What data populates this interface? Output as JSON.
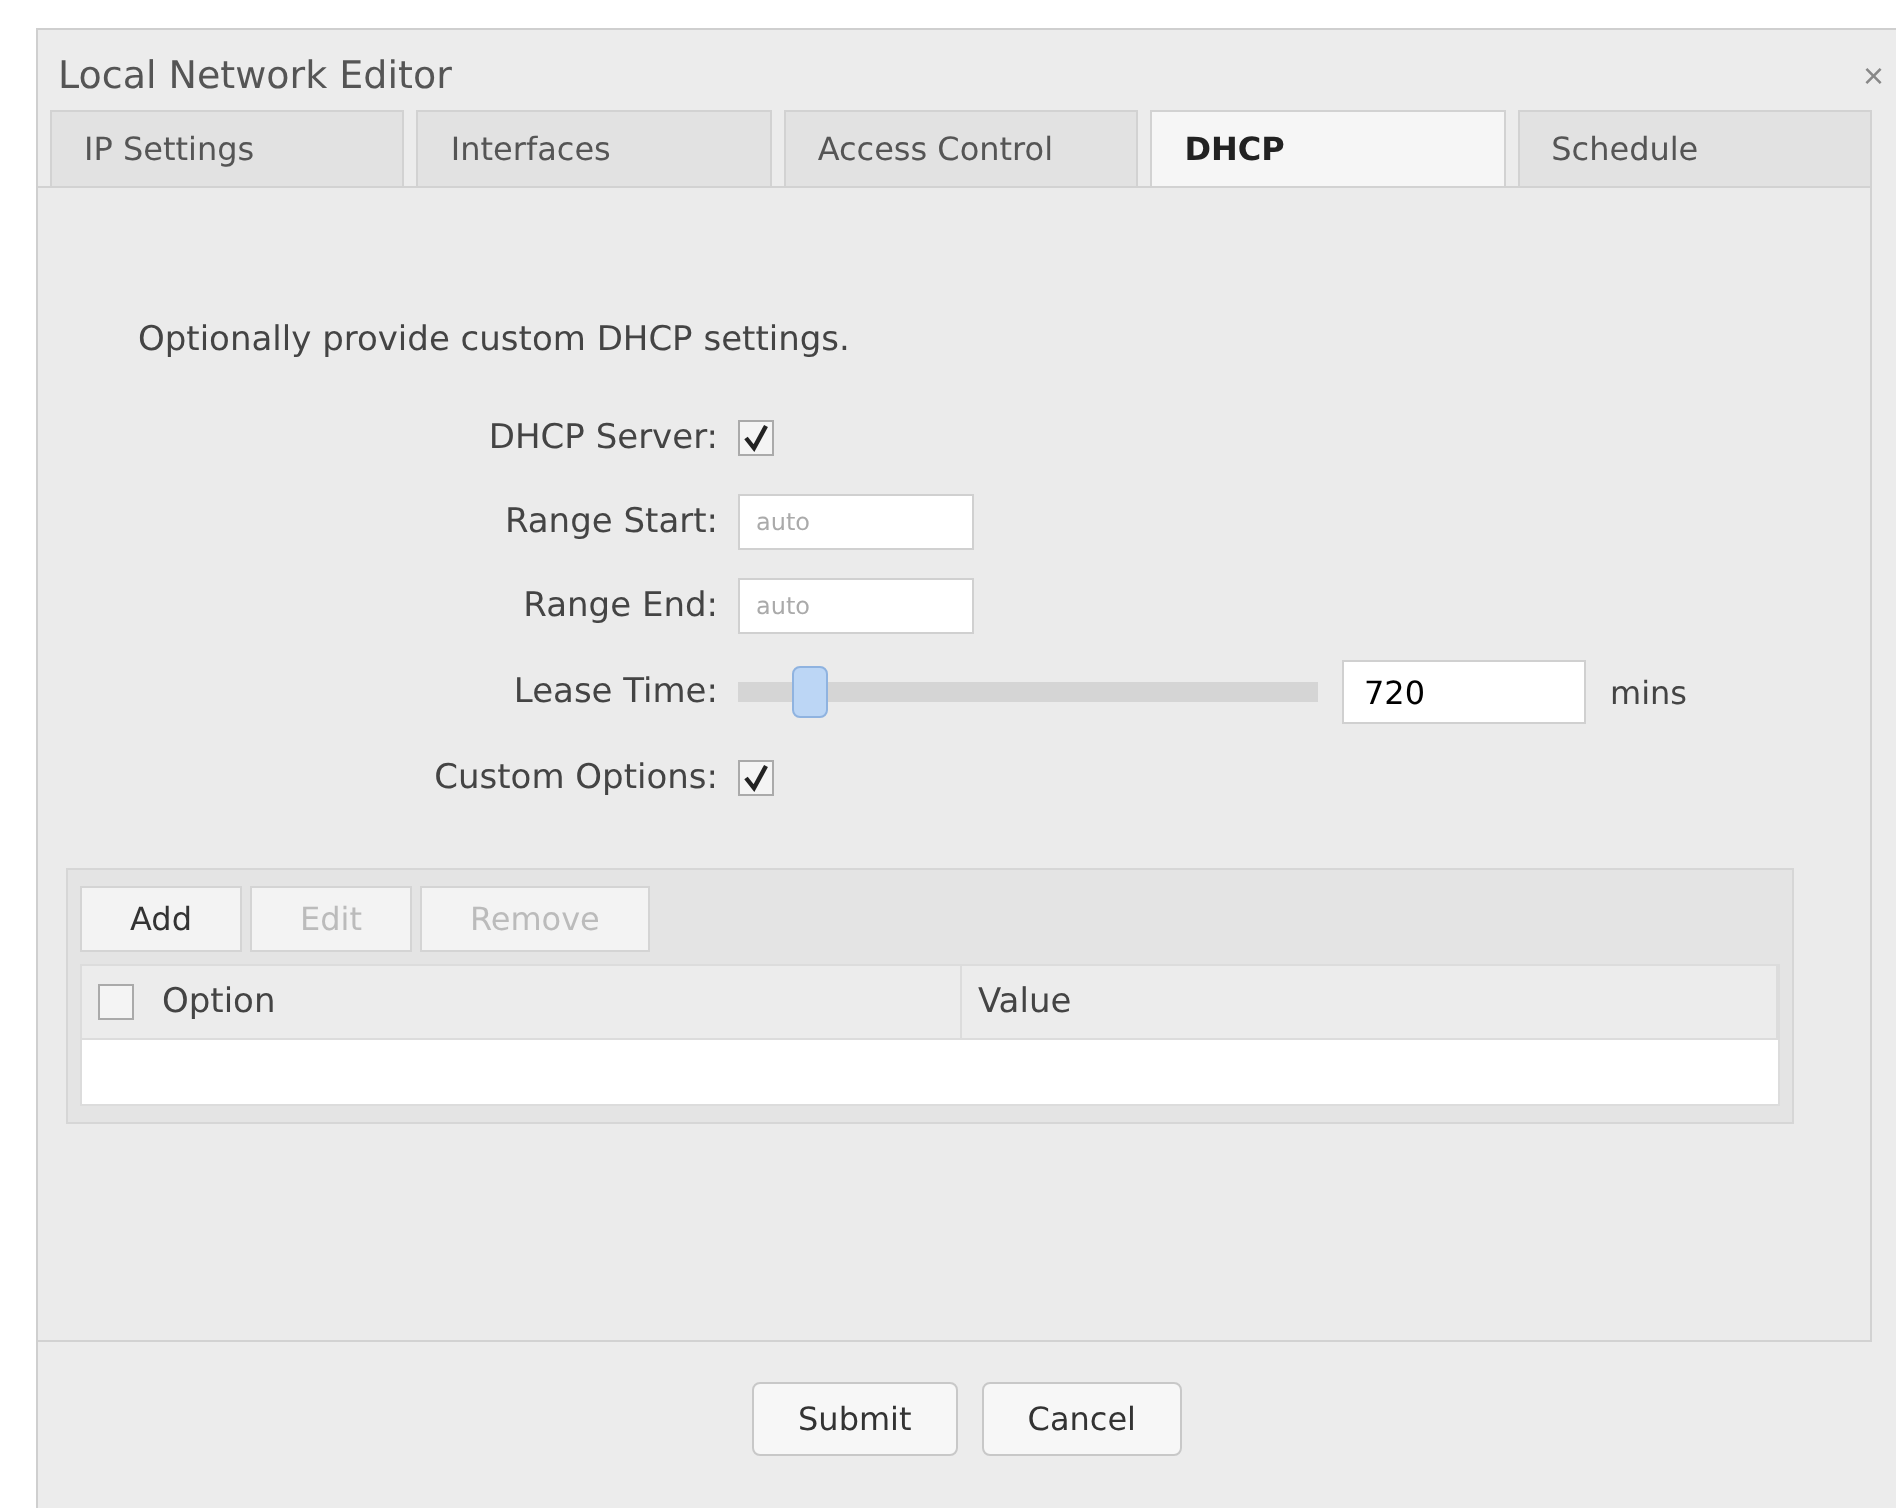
{
  "window": {
    "title": "Local Network Editor",
    "close": "×"
  },
  "tabs": [
    {
      "label": "IP Settings",
      "selected": false
    },
    {
      "label": "Interfaces",
      "selected": false
    },
    {
      "label": "Access Control",
      "selected": false
    },
    {
      "label": "DHCP",
      "selected": true
    },
    {
      "label": "Schedule",
      "selected": false
    }
  ],
  "intro": "Optionally provide custom DHCP settings.",
  "fields": [
    {
      "kind": "checkbox",
      "label": "DHCP Server:",
      "checked": true
    },
    {
      "kind": "text",
      "label": "Range Start:",
      "placeholder": "auto"
    },
    {
      "kind": "text",
      "label": "Range End:",
      "placeholder": "auto"
    },
    {
      "kind": "slider",
      "label": "Lease Time:",
      "level": 0.1,
      "value": "720",
      "unit": "mins"
    },
    {
      "kind": "checkbox",
      "label": "Custom Options:",
      "checked": true
    }
  ],
  "toolbar": [
    {
      "label": "Add",
      "disabled": false
    },
    {
      "label": "Edit",
      "disabled": true
    },
    {
      "label": "Remove",
      "disabled": true
    }
  ],
  "table": {
    "select_all": {
      "checked": false
    },
    "columns": [
      "Option",
      "Value"
    ]
  },
  "buttons": [
    "Submit",
    "Cancel"
  ]
}
